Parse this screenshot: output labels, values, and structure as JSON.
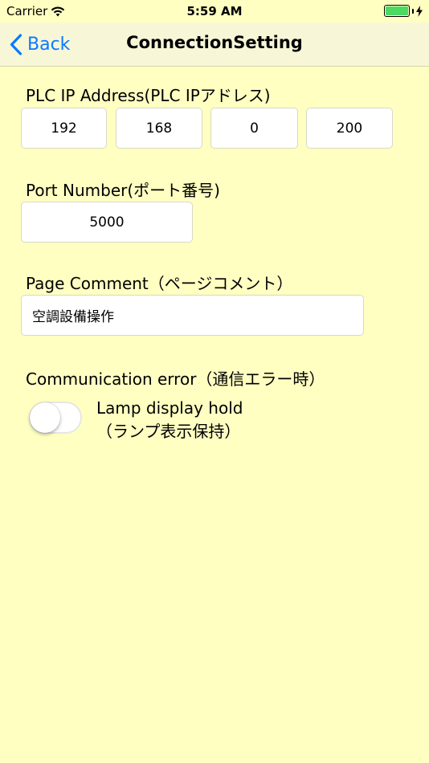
{
  "status": {
    "carrier": "Carrier",
    "time": "5:59 AM",
    "battery_level": 1.0,
    "wifi_icon": "wifi-icon",
    "charging_icon": "bolt-icon"
  },
  "nav": {
    "back_label": "Back",
    "title": "ConnectionSetting",
    "accent": "#0a7aff"
  },
  "ip": {
    "label": "PLC IP Address(PLC IPアドレス)",
    "octets": [
      "192",
      "168",
      "0",
      "200"
    ]
  },
  "port": {
    "label": "Port Number(ポート番号)",
    "value": "5000"
  },
  "comment": {
    "label": "Page Comment（ページコメント）",
    "value": "空調設備操作"
  },
  "comm_error": {
    "label": "Communication error（通信エラー時）",
    "toggle_on": false,
    "toggle_line1": "Lamp display hold",
    "toggle_line2": "（ランプ表示保持）"
  },
  "colors": {
    "background": "#ffffc2",
    "navbar": "#f7f7d8",
    "battery": "#4cd964"
  }
}
